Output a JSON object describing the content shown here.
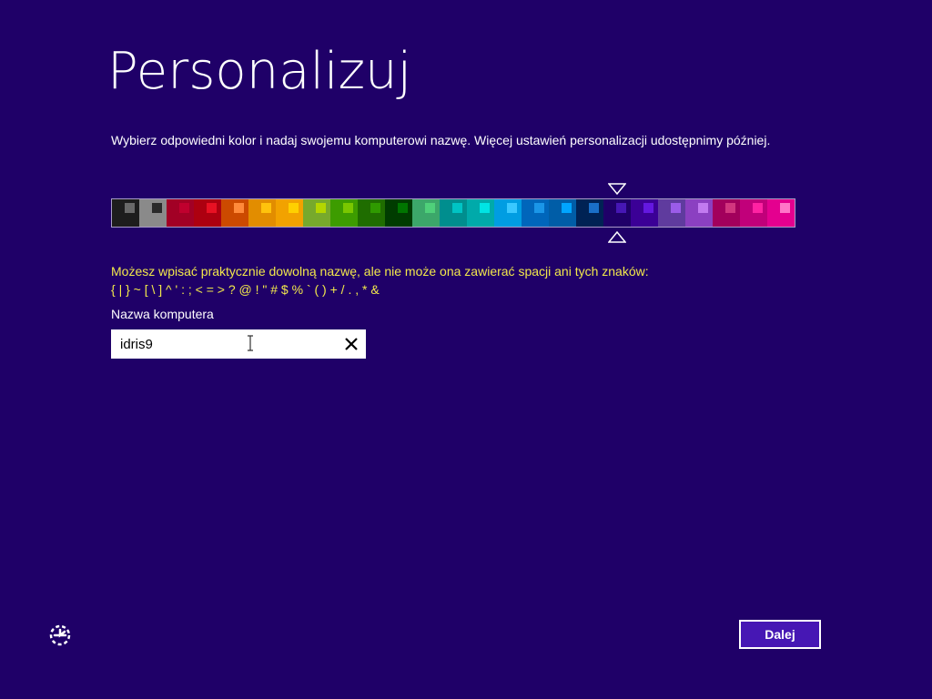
{
  "page": {
    "title": "Personalizuj",
    "description": "Wybierz odpowiedni kolor i nadaj swojemu komputerowi nazwę. Więcej ustawień personalizacji udostępnimy później.",
    "warning_line1": "Możesz wpisać praktycznie dowolną nazwę, ale nie może ona zawierać spacji ani tych znaków:",
    "warning_line2": "{ | } ~ [ \\ ] ^ ' : ; < = > ? @ ! \" # $ % ` ( ) + / . , * &"
  },
  "palette": {
    "selected_index": 18,
    "swatches": [
      {
        "bg": "#1d1d1d",
        "fg": "#696969"
      },
      {
        "bg": "#8a8a8a",
        "fg": "#2a2a2a"
      },
      {
        "bg": "#a20025",
        "fg": "#c0002e"
      },
      {
        "bg": "#ad0010",
        "fg": "#e81123"
      },
      {
        "bg": "#cc4a00",
        "fg": "#ff8a3a"
      },
      {
        "bg": "#e28d00",
        "fg": "#ffc30c"
      },
      {
        "bg": "#f2a200",
        "fg": "#ffd000"
      },
      {
        "bg": "#77a92c",
        "fg": "#b4d600"
      },
      {
        "bg": "#3d9c00",
        "fg": "#7ac700"
      },
      {
        "bg": "#1f6d00",
        "fg": "#2f9a00"
      },
      {
        "bg": "#003c00",
        "fg": "#007500"
      },
      {
        "bg": "#3ca76a",
        "fg": "#4fd07a"
      },
      {
        "bg": "#008e8e",
        "fg": "#00c4c4"
      },
      {
        "bg": "#00aaaa",
        "fg": "#00e4e4"
      },
      {
        "bg": "#009de2",
        "fg": "#3ac8ff"
      },
      {
        "bg": "#0066bb",
        "fg": "#1a96e8"
      },
      {
        "bg": "#005da7",
        "fg": "#00a5ff"
      },
      {
        "bg": "#002254",
        "fg": "#1a6fc7"
      },
      {
        "bg": "#1f0068",
        "fg": "#4617b4"
      },
      {
        "bg": "#3b0096",
        "fg": "#6418e0"
      },
      {
        "bg": "#5f3b9e",
        "fg": "#9b5ce8"
      },
      {
        "bg": "#8b40c1",
        "fg": "#c27af0"
      },
      {
        "bg": "#a2005c",
        "fg": "#d2367e"
      },
      {
        "bg": "#c1007a",
        "fg": "#ff22a2"
      },
      {
        "bg": "#e4008f",
        "fg": "#ff76c8"
      }
    ]
  },
  "form": {
    "label": "Nazwa komputera",
    "value": "idris9",
    "clear_icon": "close-icon",
    "text_cursor_icon": "i-beam-icon"
  },
  "footer": {
    "ease_of_access_icon": "ease-of-access-icon",
    "next_label": "Dalej"
  },
  "colors": {
    "background": "#1f0068",
    "warning_text": "#f2e84b",
    "button_bg": "#4617b4"
  }
}
